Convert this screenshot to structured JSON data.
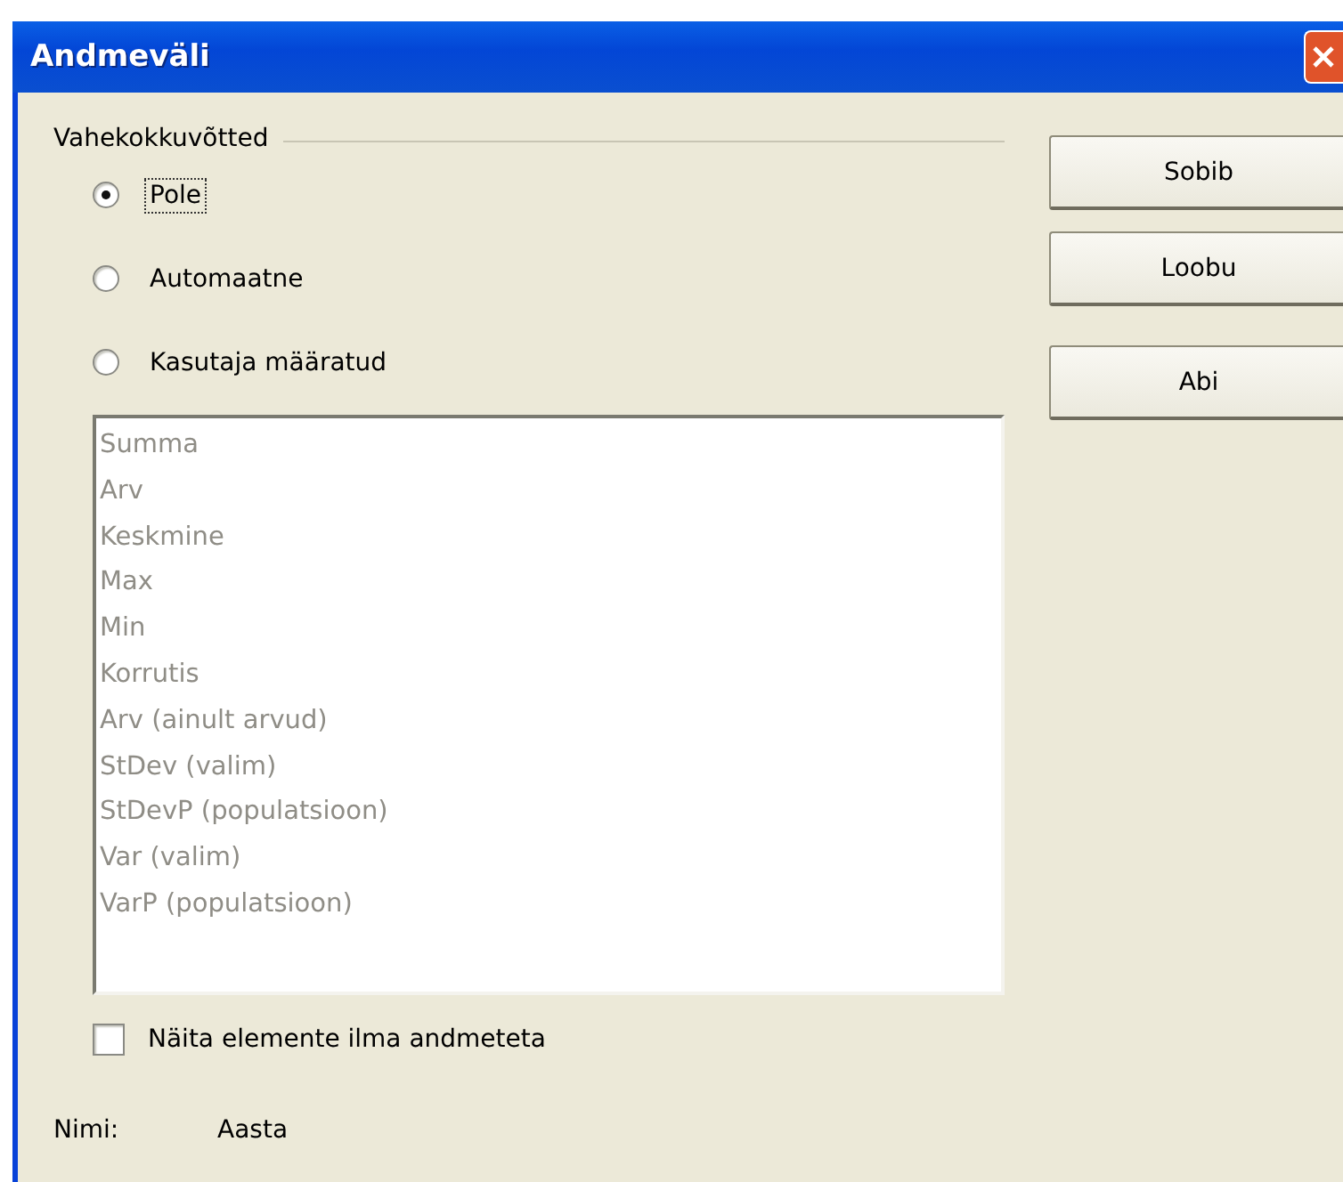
{
  "window": {
    "title": "Andmeväli"
  },
  "subtotals": {
    "label": "Vahekokkuvõtted",
    "options": [
      {
        "label": "Pole",
        "selected": true,
        "focused": true
      },
      {
        "label": "Automaatne",
        "selected": false,
        "focused": false
      },
      {
        "label": "Kasutaja määratud",
        "selected": false,
        "focused": false
      }
    ],
    "functions": {
      "disabled": true,
      "items": [
        "Summa",
        "Arv",
        "Keskmine",
        "Max",
        "Min",
        "Korrutis",
        "Arv (ainult arvud)",
        "StDev (valim)",
        "StDevP (populatsioon)",
        "Var (valim)",
        "VarP (populatsioon)"
      ]
    }
  },
  "show_empty": {
    "label": "Näita elemente ilma andmeteta",
    "checked": false
  },
  "name": {
    "label": "Nimi:",
    "value": "Aasta"
  },
  "buttons": [
    "Sobib",
    "Loobu",
    "Abi"
  ]
}
